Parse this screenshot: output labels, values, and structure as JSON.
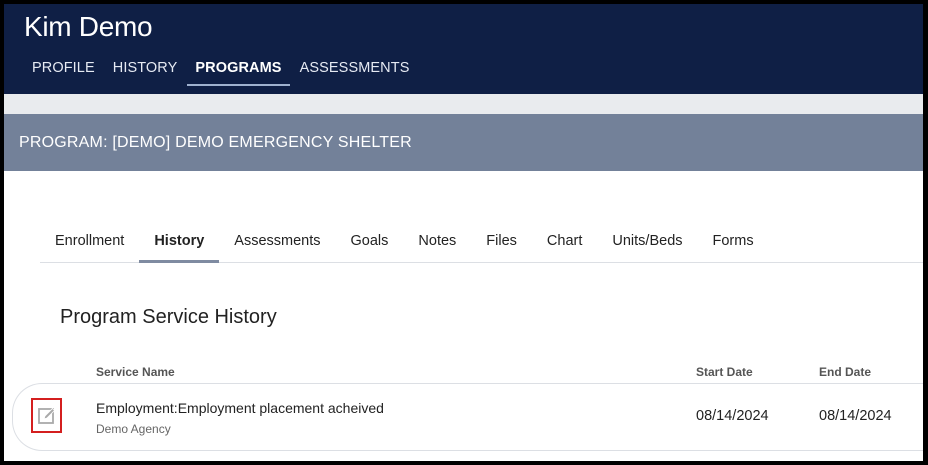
{
  "client": {
    "name": "Kim Demo"
  },
  "top_nav": [
    {
      "label": "PROFILE",
      "active": false
    },
    {
      "label": "HISTORY",
      "active": false
    },
    {
      "label": "PROGRAMS",
      "active": true
    },
    {
      "label": "ASSESSMENTS",
      "active": false
    }
  ],
  "program": {
    "title": "PROGRAM: [DEMO] DEMO EMERGENCY SHELTER"
  },
  "sub_tabs": [
    {
      "label": "Enrollment",
      "active": false
    },
    {
      "label": "History",
      "active": true
    },
    {
      "label": "Assessments",
      "active": false
    },
    {
      "label": "Goals",
      "active": false
    },
    {
      "label": "Notes",
      "active": false
    },
    {
      "label": "Files",
      "active": false
    },
    {
      "label": "Chart",
      "active": false
    },
    {
      "label": "Units/Beds",
      "active": false
    },
    {
      "label": "Forms",
      "active": false
    }
  ],
  "section": {
    "title": "Program Service History"
  },
  "table": {
    "columns": {
      "service_name": "Service Name",
      "start_date": "Start Date",
      "end_date": "End Date"
    },
    "rows": [
      {
        "service_name": "Employment:Employment placement acheived",
        "agency": "Demo Agency",
        "start_date": "08/14/2024",
        "end_date": "08/14/2024",
        "icon": "edit-icon"
      }
    ]
  },
  "colors": {
    "header_bg": "#0f1f45",
    "program_bar_bg": "#738199",
    "highlight_red": "#d41f1f"
  }
}
